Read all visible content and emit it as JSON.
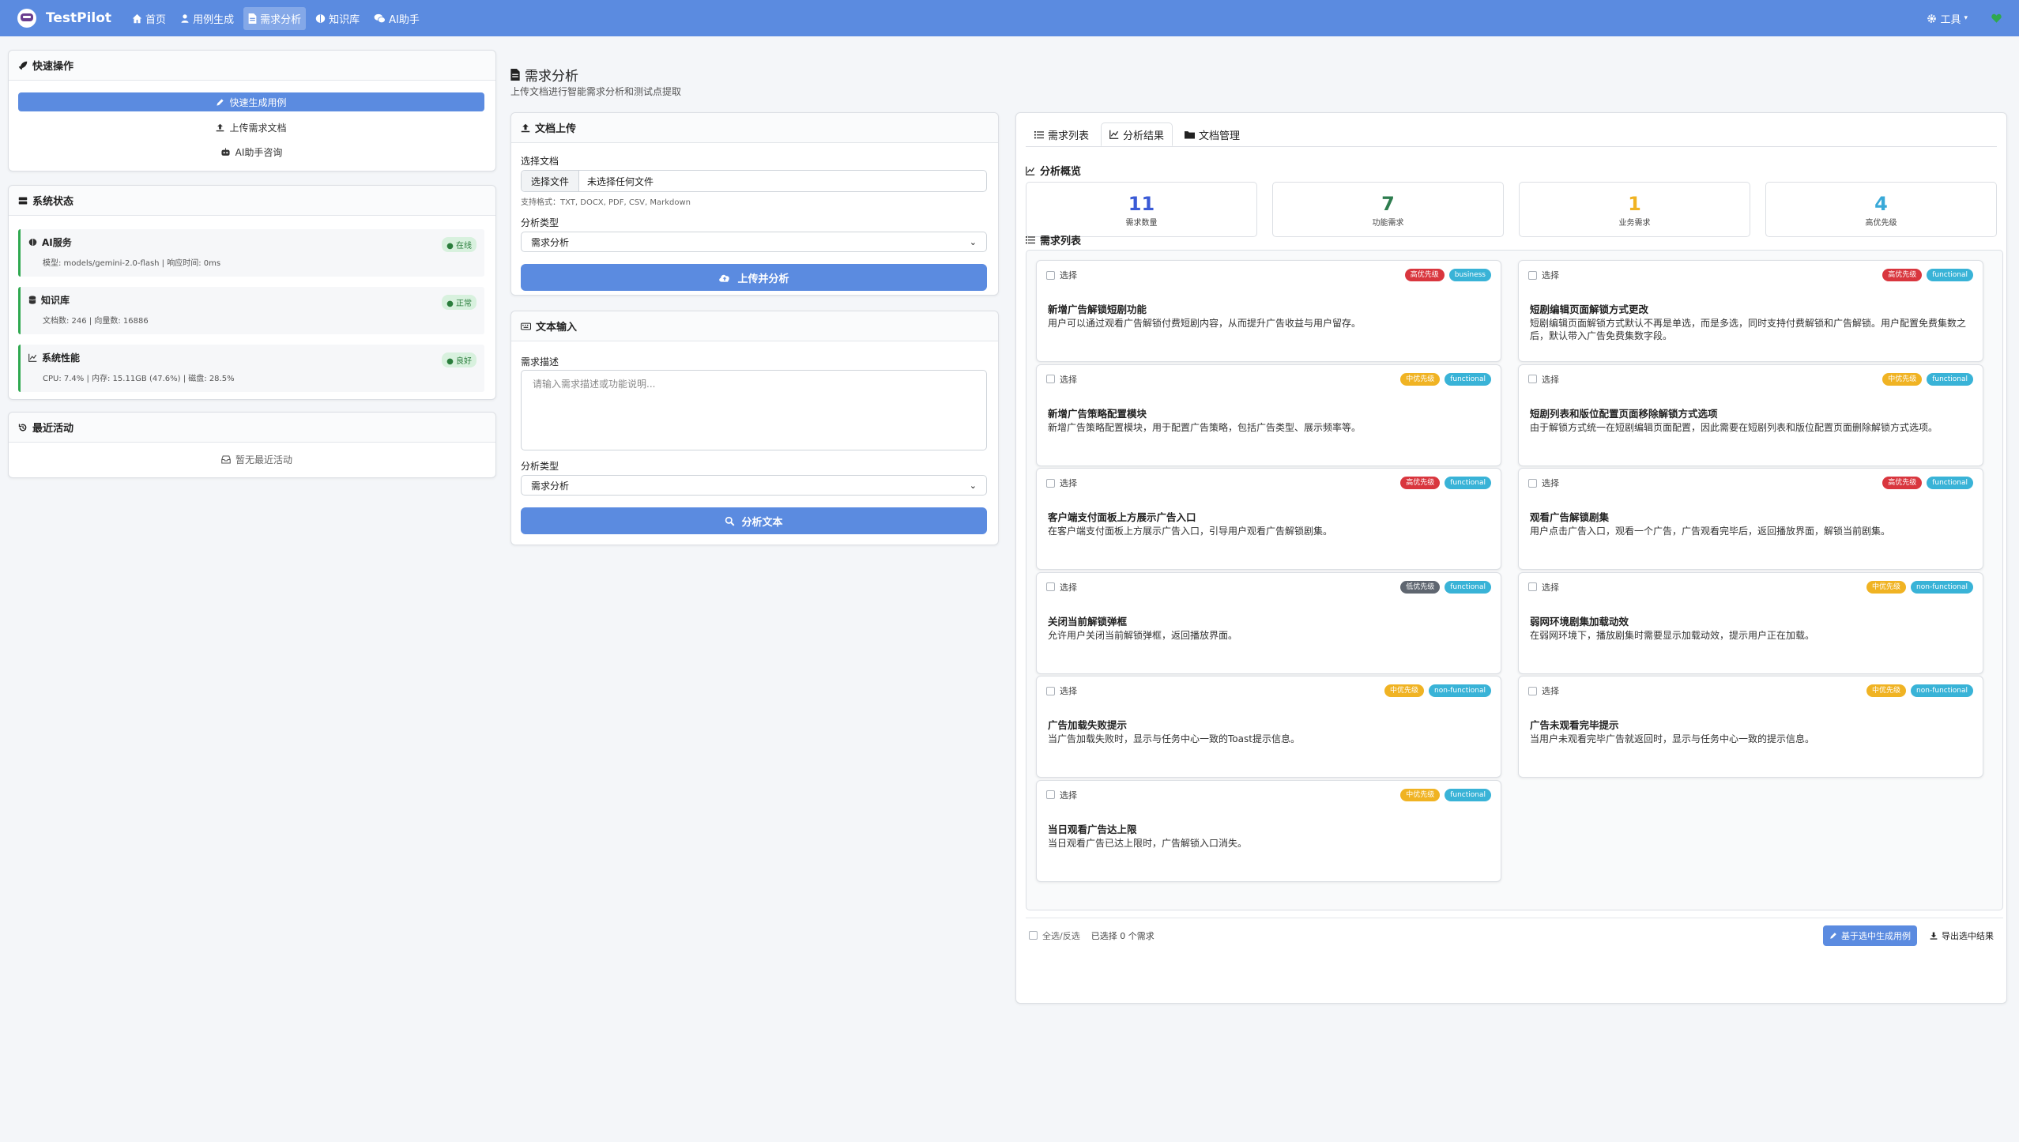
{
  "navbar": {
    "brand": "TestPilot",
    "items": [
      {
        "label": "首页",
        "icon": "home-icon"
      },
      {
        "label": "用例生成",
        "icon": "user-icon"
      },
      {
        "label": "需求分析",
        "icon": "document-icon"
      },
      {
        "label": "知识库",
        "icon": "brain-icon"
      },
      {
        "label": "AI助手",
        "icon": "chat-icon"
      }
    ],
    "tools_label": "工具",
    "accent": "#5b8be0"
  },
  "quick_actions": {
    "title": "快速操作",
    "primary": "快速生成用例",
    "upload": "上传需求文档",
    "ai": "AI助手咨询"
  },
  "system_status": {
    "title": "系统状态",
    "items": [
      {
        "name": "AI服务",
        "detail": "模型: models/gemini-2.0-flash | 响应时间: 0ms",
        "badge": "在线"
      },
      {
        "name": "知识库",
        "detail": "文档数: 246 | 向量数: 16886",
        "badge": "正常"
      },
      {
        "name": "系统性能",
        "detail": "CPU: 7.4% | 内存: 15.11GB (47.6%) | 磁盘: 28.5%",
        "badge": "良好"
      }
    ]
  },
  "recent": {
    "title": "最近活动",
    "empty": "暂无最近活动"
  },
  "page": {
    "title": "需求分析",
    "subtitle": "上传文档进行智能需求分析和测试点提取"
  },
  "upload": {
    "title": "文档上传",
    "file_label": "选择文档",
    "file_button": "选择文件",
    "file_text": "未选择任何文件",
    "hint": "支持格式：TXT, DOCX, PDF, CSV, Markdown",
    "type_label": "分析类型",
    "type_value": "需求分析",
    "button": "上传并分析"
  },
  "text_input": {
    "title": "文本输入",
    "desc_label": "需求描述",
    "placeholder": "请输入需求描述或功能说明...",
    "type_label": "分析类型",
    "type_value": "需求分析",
    "button": "分析文本"
  },
  "tabs": [
    "需求列表",
    "分析结果",
    "文档管理"
  ],
  "overview": {
    "title": "分析概览",
    "stats": [
      {
        "value": "11",
        "label": "需求数量",
        "color": "#3b5bd6"
      },
      {
        "value": "7",
        "label": "功能需求",
        "color": "#2e7d4f"
      },
      {
        "value": "1",
        "label": "业务需求",
        "color": "#f0b323"
      },
      {
        "value": "4",
        "label": "高优先级",
        "color": "#39a9d8"
      }
    ]
  },
  "requirements": {
    "title": "需求列表",
    "select_label": "选择",
    "items": [
      {
        "title": "新增广告解锁短剧功能",
        "desc": "用户可以通过观看广告解锁付费短剧内容，从而提升广告收益与用户留存。",
        "priority": "高优先级",
        "priority_color": "#d9363e",
        "type": "business"
      },
      {
        "title": "短剧编辑页面解锁方式更改",
        "desc": "短剧编辑页面解锁方式默认不再是单选，而是多选，同时支持付费解锁和广告解锁。用户配置免费集数之后，默认带入广告免费集数字段。",
        "priority": "高优先级",
        "priority_color": "#d9363e",
        "type": "functional"
      },
      {
        "title": "新增广告策略配置模块",
        "desc": "新增广告策略配置模块，用于配置广告策略，包括广告类型、展示频率等。",
        "priority": "中优先级",
        "priority_color": "#f0b323",
        "type": "functional"
      },
      {
        "title": "短剧列表和版位配置页面移除解锁方式选项",
        "desc": "由于解锁方式统一在短剧编辑页面配置，因此需要在短剧列表和版位配置页面删除解锁方式选项。",
        "priority": "中优先级",
        "priority_color": "#f0b323",
        "type": "functional"
      },
      {
        "title": "客户端支付面板上方展示广告入口",
        "desc": "在客户端支付面板上方展示广告入口，引导用户观看广告解锁剧集。",
        "priority": "高优先级",
        "priority_color": "#d9363e",
        "type": "functional"
      },
      {
        "title": "观看广告解锁剧集",
        "desc": "用户点击广告入口，观看一个广告，广告观看完毕后，返回播放界面，解锁当前剧集。",
        "priority": "高优先级",
        "priority_color": "#d9363e",
        "type": "functional"
      },
      {
        "title": "关闭当前解锁弹框",
        "desc": "允许用户关闭当前解锁弹框，返回播放界面。",
        "priority": "低优先级",
        "priority_color": "#5f6670",
        "type": "functional"
      },
      {
        "title": "弱网环境剧集加载动效",
        "desc": "在弱网环境下，播放剧集时需要显示加载动效，提示用户正在加载。",
        "priority": "中优先级",
        "priority_color": "#f0b323",
        "type": "non-functional"
      },
      {
        "title": "广告加载失败提示",
        "desc": "当广告加载失败时，显示与任务中心一致的Toast提示信息。",
        "priority": "中优先级",
        "priority_color": "#f0b323",
        "type": "non-functional"
      },
      {
        "title": "广告未观看完毕提示",
        "desc": "当用户未观看完毕广告就返回时，显示与任务中心一致的提示信息。",
        "priority": "中优先级",
        "priority_color": "#f0b323",
        "type": "non-functional"
      },
      {
        "title": "当日观看广告达上限",
        "desc": "当日观看广告已达上限时，广告解锁入口消失。",
        "priority": "中优先级",
        "priority_color": "#f0b323",
        "type": "functional"
      }
    ]
  },
  "bottom": {
    "select_all": "全选/反选",
    "selected": "已选择 0 个需求",
    "generate": "基于选中生成用例",
    "export": "导出选中结果"
  }
}
